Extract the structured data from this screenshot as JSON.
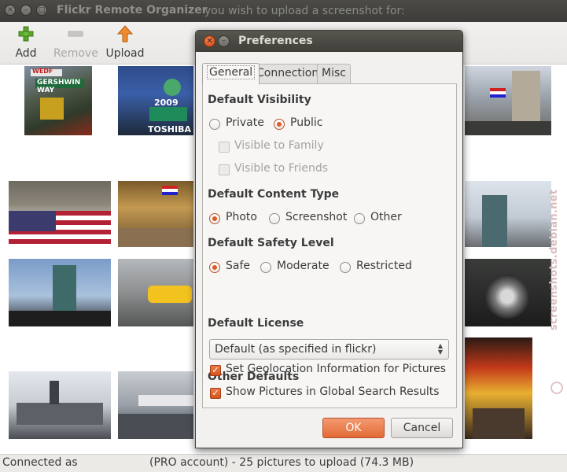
{
  "window": {
    "title": "Flickr Remote Organizer",
    "background_hint": "you wish to upload a screenshot for:"
  },
  "toolbar": {
    "add_label": "Add",
    "remove_label": "Remove",
    "upload_label": "Upload"
  },
  "status": {
    "left": "Connected as",
    "right": "(PRO account) - 25 pictures to upload (74.3 MB)"
  },
  "watermark": "screenshots.debian.net",
  "thumbnails": {
    "street_sign": "GERSHWIN WAY",
    "street_sign_top": "WEDF",
    "times_square_year": "2009",
    "times_square_brand": "TOSHIBA"
  },
  "dialog": {
    "title": "Preferences",
    "tabs": [
      "General",
      "Connection",
      "Misc"
    ],
    "active_tab": "General",
    "visibility": {
      "heading": "Default Visibility",
      "private": "Private",
      "public": "Public",
      "family": "Visible to Family",
      "friends": "Visible to Friends",
      "selected": "Public"
    },
    "content_type": {
      "heading": "Default Content Type",
      "photo": "Photo",
      "screenshot": "Screenshot",
      "other": "Other",
      "selected": "Photo"
    },
    "safety": {
      "heading": "Default Safety Level",
      "safe": "Safe",
      "moderate": "Moderate",
      "restricted": "Restricted",
      "selected": "Safe"
    },
    "license": {
      "heading": "Default License",
      "value": "Default (as specified in flickr)"
    },
    "other": {
      "heading": "Other Defaults",
      "geolocation": "Set Geolocation Information for Pictures",
      "global_search": "Show Pictures in Global Search Results",
      "geolocation_checked": true,
      "global_search_checked": true
    },
    "ok_label": "OK",
    "cancel_label": "Cancel"
  },
  "colors": {
    "accent": "#e05a24",
    "titlebar": "#3d3c38",
    "dialog_bg": "#f2f1f0"
  }
}
